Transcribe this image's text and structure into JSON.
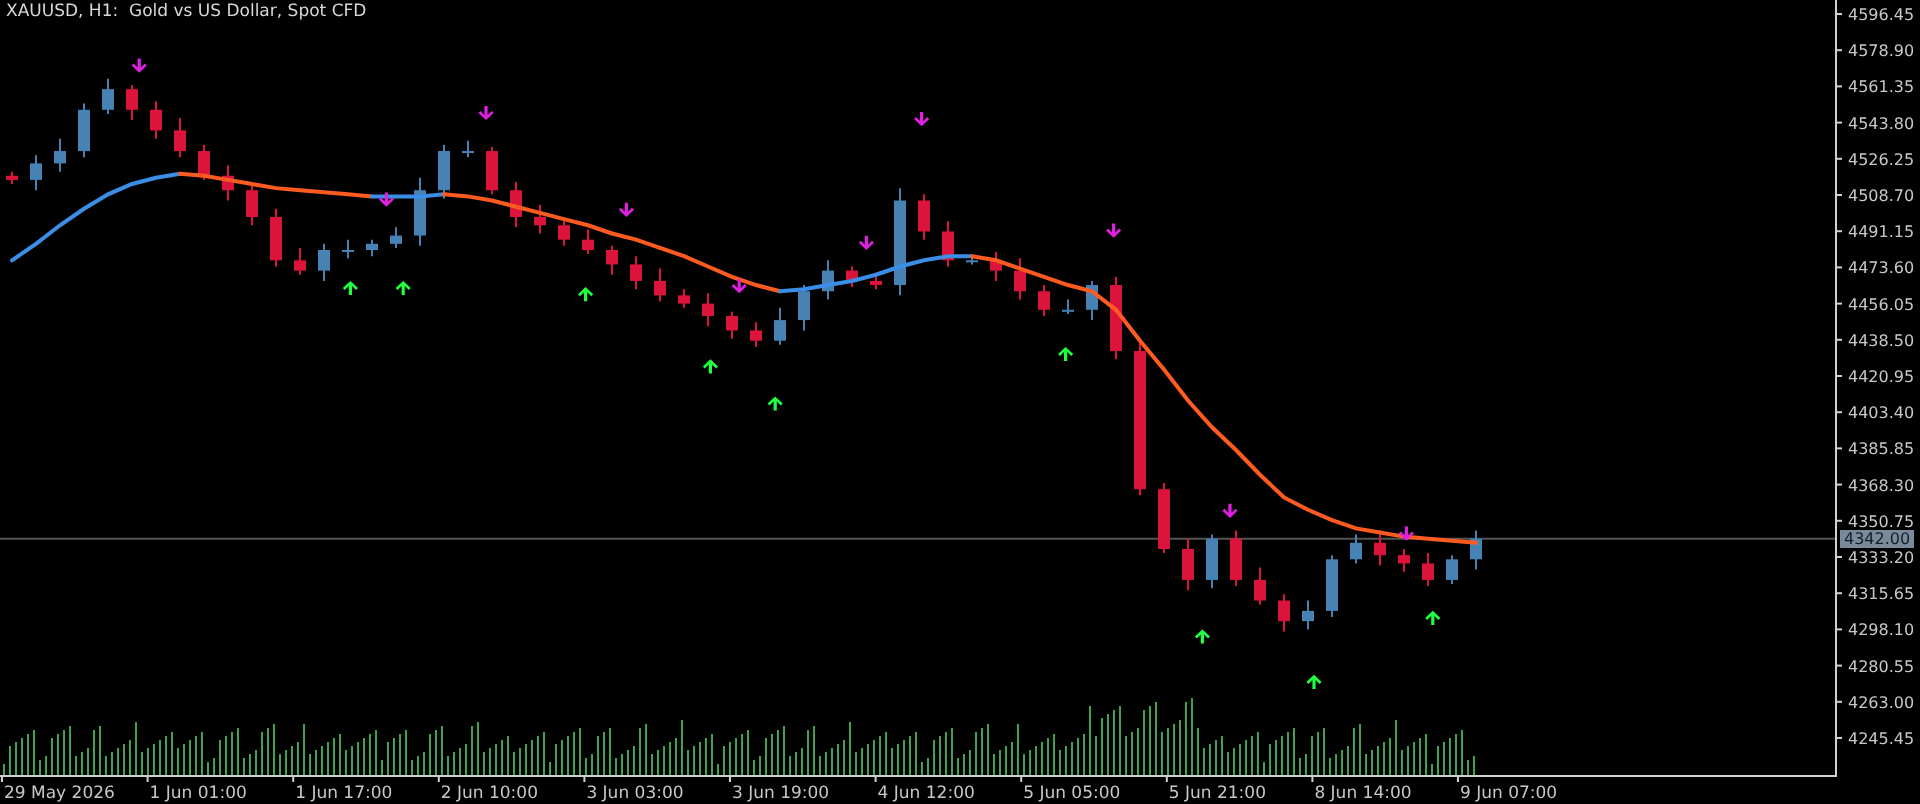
{
  "chart": {
    "title": "XAUUSD, H1:  Gold vs US Dollar, Spot CFD",
    "price_axis": [
      "4596.45",
      "4578.90",
      "4561.35",
      "4543.80",
      "4526.25",
      "4508.70",
      "4491.15",
      "4473.60",
      "4456.05",
      "4438.50",
      "4420.95",
      "4403.40",
      "4385.85",
      "4368.30",
      "4350.75",
      "4333.20",
      "4315.65",
      "4298.10",
      "4280.55",
      "4263.00",
      "4245.45"
    ],
    "time_axis": [
      "29 May 2026",
      "1 Jun 01:00",
      "1 Jun 17:00",
      "2 Jun 10:00",
      "3 Jun 03:00",
      "3 Jun 19:00",
      "4 Jun 12:00",
      "5 Jun 05:00",
      "5 Jun 21:00",
      "8 Jun 14:00",
      "9 Jun 07:00"
    ],
    "current_price": "4342.00"
  }
}
